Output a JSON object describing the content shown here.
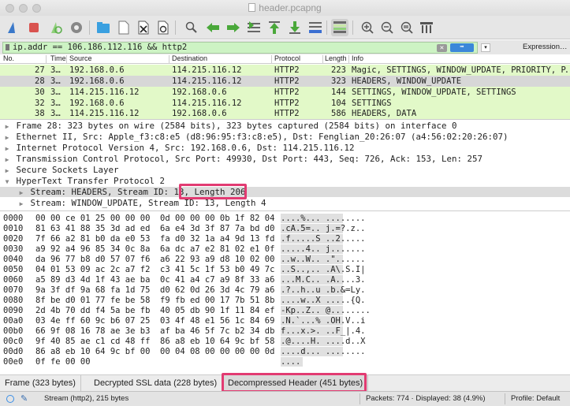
{
  "window": {
    "title": "header.pcapng"
  },
  "filter": {
    "value": "ip.addr == 106.186.112.116 && http2",
    "expression_label": "Expression…"
  },
  "packet_list": {
    "headers": {
      "no": "No.",
      "time": "Time",
      "source": "Source",
      "destination": "Destination",
      "protocol": "Protocol",
      "length": "Length",
      "info": "Info"
    },
    "rows": [
      {
        "no": "27",
        "time": "3…",
        "source": "192.168.0.6",
        "destination": "114.215.116.12",
        "protocol": "HTTP2",
        "length": "223",
        "info": "Magic, SETTINGS, WINDOW_UPDATE, PRIORITY, P…"
      },
      {
        "no": "28",
        "time": "3…",
        "source": "192.168.0.6",
        "destination": "114.215.116.12",
        "protocol": "HTTP2",
        "length": "323",
        "info": "HEADERS, WINDOW_UPDATE"
      },
      {
        "no": "30",
        "time": "3…",
        "source": "114.215.116.12",
        "destination": "192.168.0.6",
        "protocol": "HTTP2",
        "length": "144",
        "info": "SETTINGS, WINDOW_UPDATE, SETTINGS"
      },
      {
        "no": "32",
        "time": "3…",
        "source": "192.168.0.6",
        "destination": "114.215.116.12",
        "protocol": "HTTP2",
        "length": "104",
        "info": "SETTINGS"
      },
      {
        "no": "38",
        "time": "3…",
        "source": "114.215.116.12",
        "destination": "192.168.0.6",
        "protocol": "HTTP2",
        "length": "586",
        "info": "HEADERS, DATA"
      }
    ]
  },
  "details": {
    "rows": [
      {
        "text": "Frame 28: 323 bytes on wire (2584 bits), 323 bytes captured (2584 bits) on interface 0"
      },
      {
        "text": "Ethernet II, Src: Apple_f3:c8:e5 (d8:96:95:f3:c8:e5), Dst: Fenglian_20:26:07 (a4:56:02:20:26:07)"
      },
      {
        "text": "Internet Protocol Version 4, Src: 192.168.0.6, Dst: 114.215.116.12"
      },
      {
        "text": "Transmission Control Protocol, Src Port: 49930, Dst Port: 443, Seq: 726, Ack: 153, Len: 257"
      },
      {
        "text": "Secure Sockets Layer"
      },
      {
        "text": "HyperText Transfer Protocol 2"
      },
      {
        "text": "Stream: HEADERS, Stream ID: 13, Length 206"
      },
      {
        "text": "Stream: WINDOW_UPDATE, Stream ID: 13, Length 4"
      }
    ]
  },
  "bytes": {
    "rows": [
      {
        "offset": "0000",
        "hex": "00 00 ce 01 25 00 00 00  0d 00 00 00 0b 1f 82 04",
        "ascii": "....%... ........"
      },
      {
        "offset": "0010",
        "hex": "81 63 41 88 35 3d ad ed  6a e4 3d 3f 87 7a bd d0",
        "ascii": ".cA.5=.. j.=?.z.."
      },
      {
        "offset": "0020",
        "hex": "7f 66 a2 81 b0 da e0 53  fa d0 32 1a a4 9d 13 fd",
        "ascii": ".f.....S ..2....."
      },
      {
        "offset": "0030",
        "hex": "a9 92 a4 96 85 34 0c 8a  6a dc a7 e2 81 02 e1 0f",
        "ascii": ".....4.. j......."
      },
      {
        "offset": "0040",
        "hex": "da 96 77 b8 d0 57 07 f6  a6 22 93 a9 d8 10 02 00",
        "ascii": "..w..W.. .\"......"
      },
      {
        "offset": "0050",
        "hex": "04 01 53 09 ac 2c a7 f2  c3 41 5c 1f 53 b0 49 7c",
        "ascii": "..S..,.. .A\\.S.I|"
      },
      {
        "offset": "0060",
        "hex": "a5 89 d3 4d 1f 43 ae ba  0c 41 a4 c7 a9 8f 33 a6",
        "ascii": "...M.C.. .A....3."
      },
      {
        "offset": "0070",
        "hex": "9a 3f df 9a 68 fa 1d 75  d0 62 0d 26 3d 4c 79 a6",
        "ascii": ".?..h..u .b.&=Ly."
      },
      {
        "offset": "0080",
        "hex": "8f be d0 01 77 fe be 58  f9 fb ed 00 17 7b 51 8b",
        "ascii": "....w..X .....{Q."
      },
      {
        "offset": "0090",
        "hex": "2d 4b 70 dd f4 5a be fb  40 05 db 90 1f 11 84 ef",
        "ascii": "-Kp..Z.. @........"
      },
      {
        "offset": "00a0",
        "hex": "03 4e ff 60 9c b6 07 25  03 4f 48 e1 56 1c 84 69",
        "ascii": ".N.`...% .OH.V..i"
      },
      {
        "offset": "00b0",
        "hex": "66 9f 08 16 78 ae 3e b3  af ba 46 5f 7c b2 34 db",
        "ascii": "f...x.>. ..F_|.4."
      },
      {
        "offset": "00c0",
        "hex": "9f 40 85 ae c1 cd 48 ff  86 a8 eb 10 64 9c bf 58",
        "ascii": ".@....H. ....d..X"
      },
      {
        "offset": "00d0",
        "hex": "86 a8 eb 10 64 9c bf 00  00 04 08 00 00 00 00 0d",
        "ascii": "....d... ........"
      },
      {
        "offset": "00e0",
        "hex": "0f fe 00 00",
        "ascii": "...."
      }
    ]
  },
  "tabs": [
    {
      "label": "Frame (323 bytes)"
    },
    {
      "label": "Decrypted SSL data (228 bytes)"
    },
    {
      "label": "Decompressed Header (451 bytes)"
    }
  ],
  "status": {
    "left": "Stream (http2), 215 bytes",
    "packets": "Packets: 774 · Displayed: 38 (4.9%)",
    "profile": "Profile: Default"
  },
  "colors": {
    "http2_row": "#e2f9c8",
    "selected_row": "#d7d7d7",
    "filter_valid": "#cdf3c4",
    "highlight": "#e23b72"
  },
  "icons": [
    "shark-fin-icon",
    "stop-icon",
    "restart-icon",
    "capture-options-icon",
    "open-folder-icon",
    "file-icon",
    "close-file-icon",
    "reload-icon",
    "find-icon",
    "back-arrow-icon",
    "forward-arrow-icon",
    "goto-packet-icon",
    "first-packet-icon",
    "last-packet-icon",
    "autoscroll-icon",
    "colorize-icon",
    "zoom-in-icon",
    "zoom-out-icon",
    "normal-size-icon",
    "resize-columns-icon"
  ]
}
